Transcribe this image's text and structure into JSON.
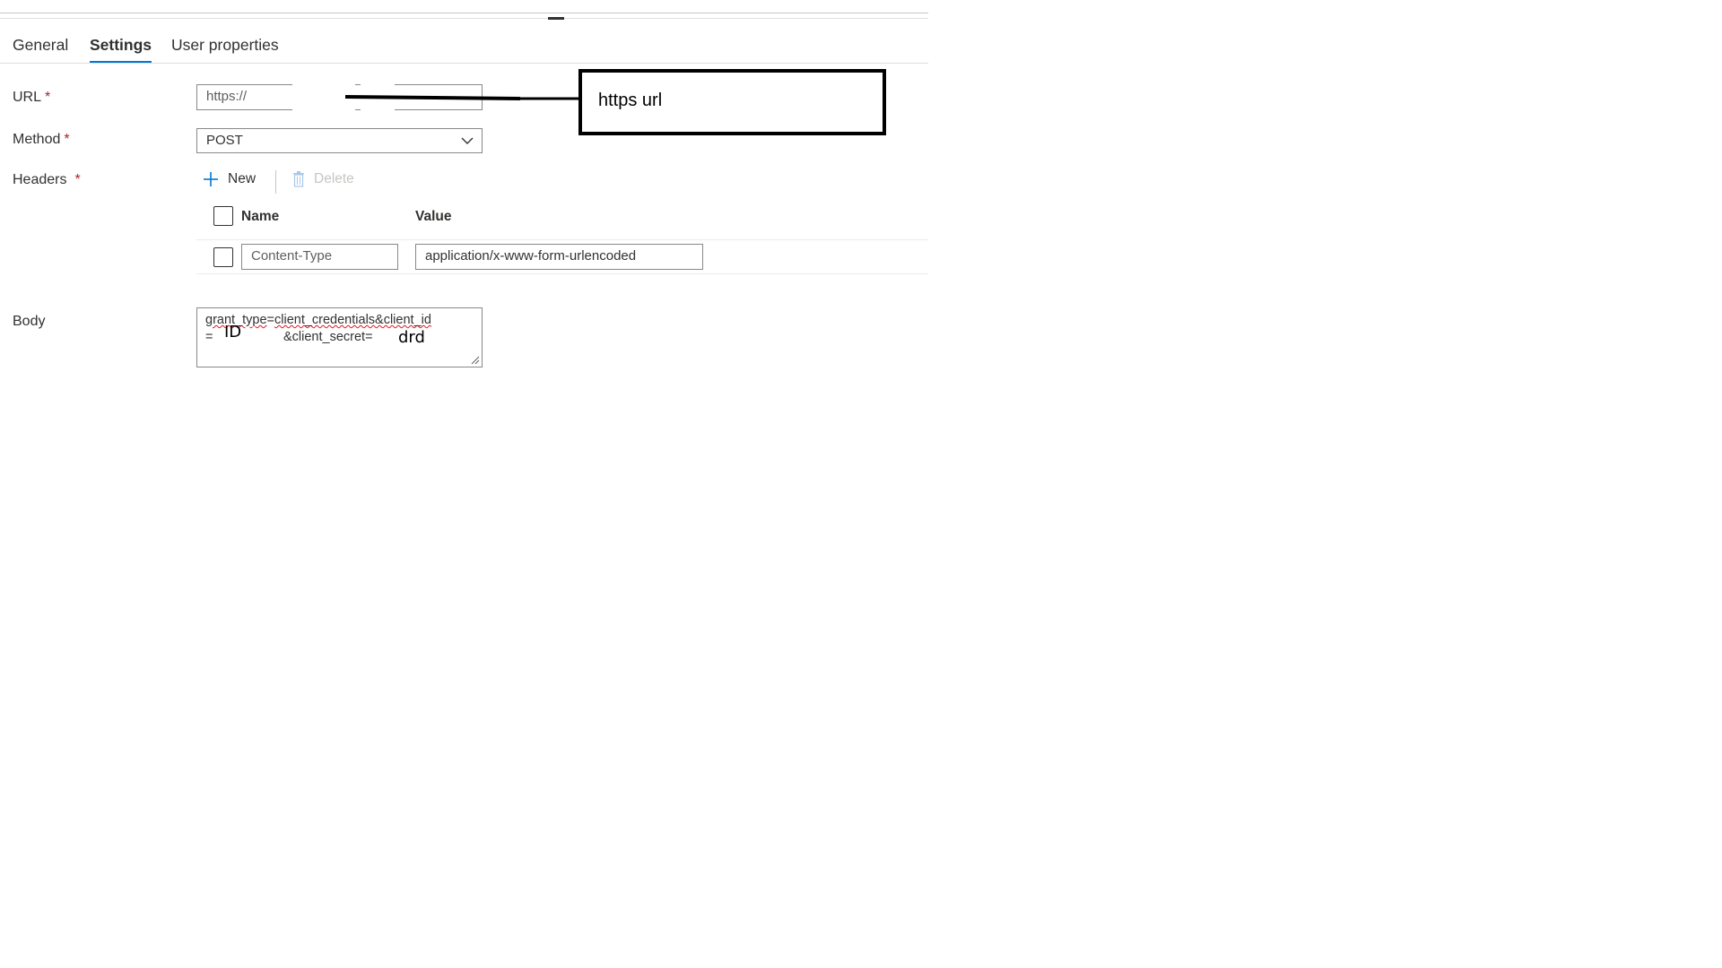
{
  "tabs": [
    {
      "label": "General",
      "active": false
    },
    {
      "label": "Settings",
      "active": true
    },
    {
      "label": "User properties",
      "active": false
    }
  ],
  "fields": {
    "url_label": "URL",
    "method_label": "Method",
    "headers_label": "Headers",
    "body_label": "Body",
    "required_mark": "*"
  },
  "url": {
    "value": "https://"
  },
  "method": {
    "selected": "POST"
  },
  "headers_toolbar": {
    "new_label": "New",
    "delete_label": "Delete"
  },
  "headers_table": {
    "columns": [
      "Name",
      "Value"
    ],
    "rows": [
      {
        "name": "Content-Type",
        "value": "application/x-www-form-urlencoded"
      }
    ]
  },
  "body": {
    "line1_part1": "grant_type",
    "line1_part2": "=",
    "line1_part3": "client_credentials&client_id",
    "line2_eq": "=",
    "line2_secret": "&client_secret=",
    "handwritten_id": "ID",
    "handwritten_secret": "drd"
  },
  "annotation": {
    "text": "https url"
  },
  "colors": {
    "accent": "#0078d4",
    "required": "#a4262c",
    "border": "#8a8886",
    "disabled": "#c8c6c4"
  }
}
